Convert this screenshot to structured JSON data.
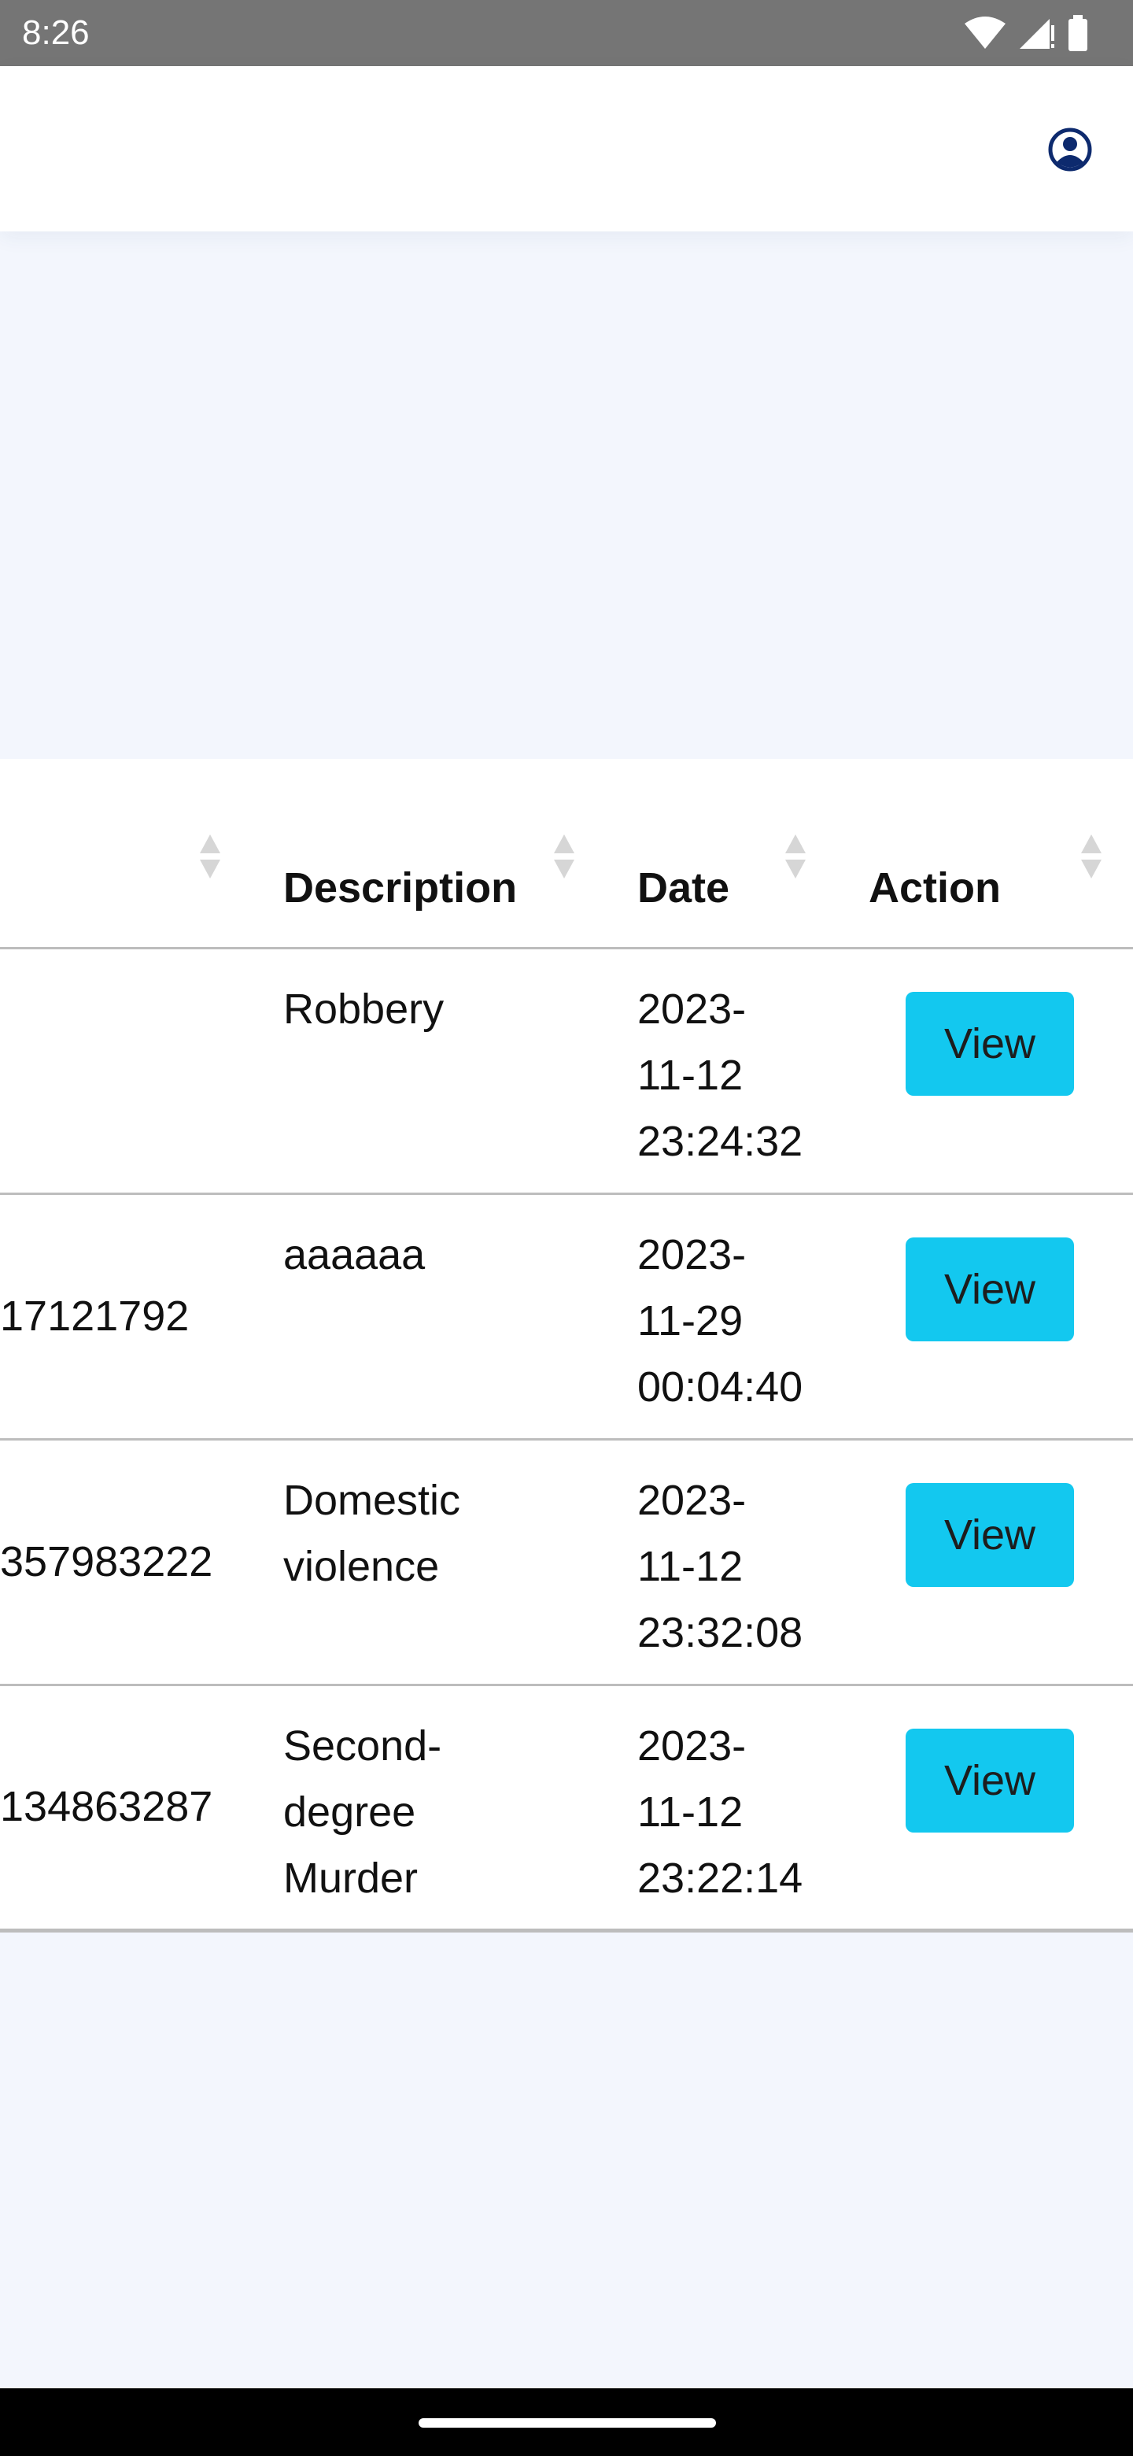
{
  "status_bar": {
    "time": "8:26"
  },
  "table": {
    "columns": [
      {
        "label": ""
      },
      {
        "label": "Description"
      },
      {
        "label": "Date"
      },
      {
        "label": "Action"
      }
    ],
    "rows": [
      {
        "id": "",
        "description": [
          "Robbery"
        ],
        "date": [
          "2023-",
          "11-12",
          "23:24:32"
        ],
        "action": "View"
      },
      {
        "id": "17121792",
        "description": [
          "aaaaaa"
        ],
        "date": [
          "2023-",
          "11-29",
          "00:04:40"
        ],
        "action": "View"
      },
      {
        "id": "357983222",
        "description": [
          "Domestic",
          "violence"
        ],
        "date": [
          "2023-",
          "11-12",
          "23:32:08"
        ],
        "action": "View"
      },
      {
        "id": "134863287",
        "description": [
          "Second-",
          "degree",
          "Murder"
        ],
        "date": [
          "2023-",
          "11-12",
          "23:22:14"
        ],
        "action": "View"
      }
    ]
  },
  "colors": {
    "accent": "#13c8ef",
    "page_bg": "#f3f6fd",
    "status_bar": "#757575",
    "profile_icon": "#0d2a6e"
  },
  "icons": {
    "profile": "account-circle-icon",
    "sort": "sort-arrows-icon",
    "wifi": "wifi-icon",
    "signal": "signal-icon",
    "battery": "battery-icon"
  }
}
